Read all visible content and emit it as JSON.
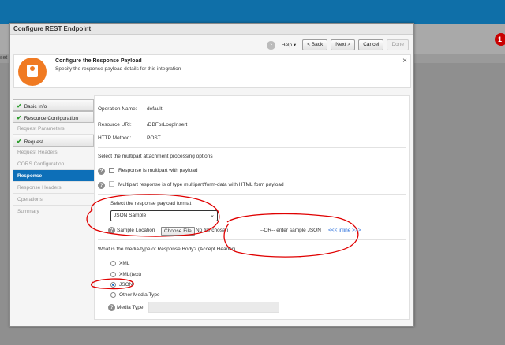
{
  "background": {
    "left_text": "set",
    "badge": "1"
  },
  "dialog": {
    "title": "Configure REST Endpoint"
  },
  "toolbar": {
    "help": "Help ▾",
    "back": "< Back",
    "next": "Next >",
    "cancel": "Cancel",
    "done": "Done"
  },
  "header": {
    "title": "Configure the Response Payload",
    "subtitle": "Specify the response payload details for this integration",
    "close": "×"
  },
  "nav": {
    "basic_info": "Basic Info",
    "resource_configuration": "Resource Configuration",
    "request_parameters": "Request Parameters",
    "request": "Request",
    "request_headers": "Request Headers",
    "cors_configuration": "CORS Configuration",
    "response": "Response",
    "response_headers": "Response Headers",
    "operations": "Operations",
    "summary": "Summary"
  },
  "details": {
    "operation_name_label": "Operation Name:",
    "operation_name": "default",
    "resource_uri_label": "Resource URI:",
    "resource_uri": "/DBForLoopInsert",
    "http_method_label": "HTTP Method:",
    "http_method": "POST"
  },
  "multipart": {
    "heading": "Select the multipart attachment processing options",
    "option1": "Response is multipart with payload",
    "option2": "Multipart response is of type multipart/form-data with HTML form payload"
  },
  "payload": {
    "format_label": "Select the response payload format",
    "format_selected": "JSON Sample",
    "sample_location_label": "Sample Location",
    "choose_file": "Choose File",
    "no_file": "No file chosen",
    "or_text": "--OR-- enter sample JSON",
    "inline_link": "<<< inline >>>"
  },
  "media": {
    "heading": "What is the media-type of Response Body? (Accept Header)",
    "options": [
      "XML",
      "XML(text)",
      "JSON",
      "Other Media Type"
    ],
    "selected": "JSON",
    "media_type_label": "Media Type"
  },
  "colors": {
    "accent": "#0d6fb8",
    "header_icon": "#f07a22",
    "annotation": "#e00000"
  }
}
